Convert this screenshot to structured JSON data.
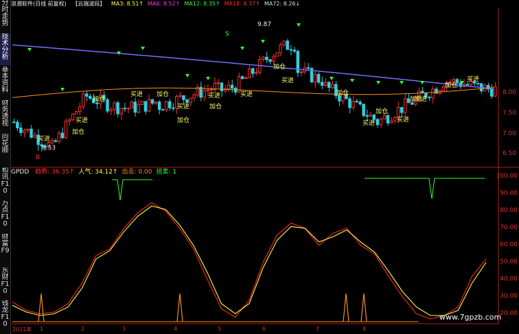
{
  "header": {
    "title": "浪潮软件(日线 前复权)",
    "indicator_name": "【云端波段】",
    "ma": [
      {
        "label": "MA3: 8.51",
        "arrow": "↑",
        "color": "#ffff33"
      },
      {
        "label": "MA6: 8.52",
        "arrow": "↑",
        "color": "#ff33ff"
      },
      {
        "label": "MA12: 8.35",
        "arrow": "↑",
        "color": "#33ff33"
      },
      {
        "label": "MA18: 8.37",
        "arrow": "↑",
        "color": "#ff3333"
      },
      {
        "label": "MA72: 8.26",
        "arrow": "↓",
        "color": "#dddddd"
      }
    ]
  },
  "sidebar": {
    "tabs": [
      "分时走势",
      "技术分析",
      "基本资料",
      "财务透视",
      "同花顺",
      "和讯F10",
      "万点F10",
      "财富F9",
      "东财F10",
      "钱龙F10"
    ]
  },
  "price_chart": {
    "price_labels": [
      "8.00",
      "7.50",
      "7.00",
      "6.50"
    ],
    "annotations": [
      "9.87",
      "6.53",
      "B",
      "S"
    ],
    "signals": [
      "买进",
      "加仓"
    ],
    "colors": {
      "up": "#ff3030",
      "down": "#30d0e0",
      "ma_long": "#7070ff",
      "ma_mid": "#ff9020",
      "signal_text": "#ffff66"
    }
  },
  "indicator": {
    "name": "GPDD",
    "items": [
      {
        "label": "趋势: 36.35",
        "arrow": "↑",
        "color": "#ff3030"
      },
      {
        "label": "人气: 34.12",
        "arrow": "↑",
        "color": "#ffff33"
      },
      {
        "label": "出击: 0.00",
        "arrow": "",
        "color": "#ff9020"
      },
      {
        "label": "班卖: 1",
        "arrow": "",
        "color": "#33ff33"
      }
    ],
    "y_labels": [
      "100.00",
      "90.00",
      "80.00",
      "70.00",
      "60.00",
      "50.00",
      "40.00",
      "30.00",
      "20.00"
    ]
  },
  "chart_data": {
    "type": "line",
    "x": [
      1,
      2,
      3,
      4,
      5,
      6,
      7,
      8,
      9,
      10,
      11,
      12,
      13,
      14,
      15,
      16,
      17,
      18,
      19,
      20,
      21,
      22,
      23,
      24,
      25,
      26,
      27,
      28,
      29,
      30,
      31,
      32,
      33,
      34,
      35
    ],
    "ylim": [
      15,
      100
    ],
    "series": [
      {
        "name": "趋势",
        "values": [
          27,
          22,
          20,
          21,
          26,
          38,
          54,
          58,
          70,
          79,
          85,
          80,
          70,
          58,
          40,
          23,
          18,
          28,
          50,
          66,
          73,
          70,
          60,
          67,
          70,
          60,
          55,
          42,
          30,
          20,
          17,
          19,
          24,
          42,
          52
        ]
      },
      {
        "name": "人气",
        "values": [
          25,
          21,
          19,
          20,
          24,
          35,
          52,
          57,
          68,
          77,
          83,
          81,
          72,
          60,
          44,
          26,
          20,
          26,
          47,
          63,
          71,
          70,
          62,
          65,
          69,
          62,
          56,
          45,
          33,
          24,
          19,
          19,
          22,
          38,
          50
        ]
      }
    ],
    "x_labels": [
      "2011年",
      "1",
      "2",
      "3",
      "4",
      "5",
      "6",
      "7",
      "8"
    ]
  },
  "watermark": "www.7gpzb.com"
}
